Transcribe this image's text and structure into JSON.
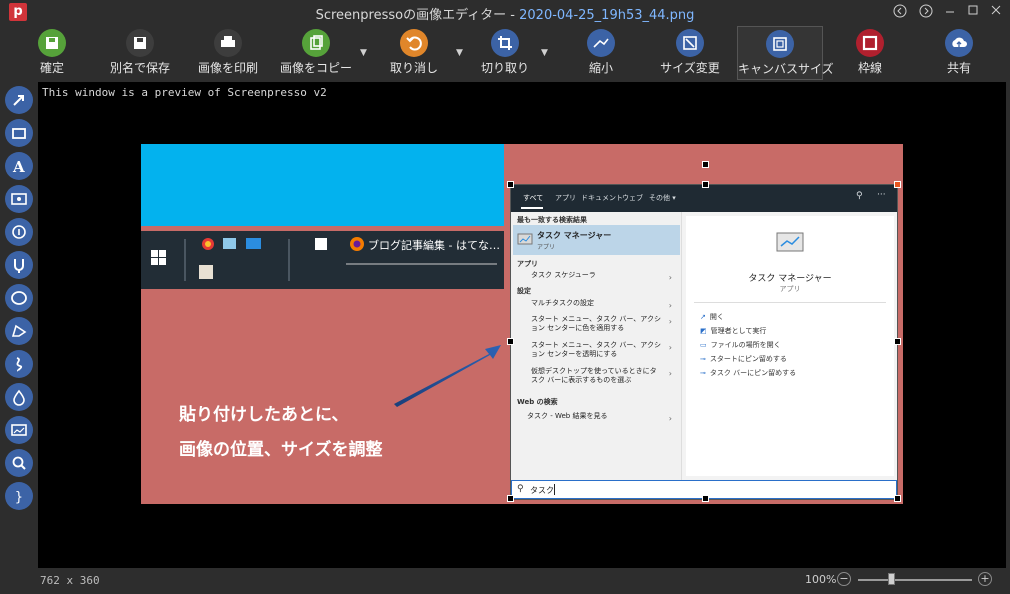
{
  "window": {
    "title_prefix": "Screenpressoの画像エディター -",
    "title_file": "2020-04-25_19h53_44.png",
    "logo_letter": "p"
  },
  "titlebar_controls": [
    "back-icon",
    "forward-icon",
    "minimize-icon",
    "maximize-icon",
    "close-icon"
  ],
  "toolbar": {
    "tools": [
      {
        "label": "確定",
        "icon": "save-icon",
        "color": "#56a23a"
      },
      {
        "label": "別名で保存",
        "icon": "save-as-icon",
        "color": "#3d3d3d"
      },
      {
        "label": "画像を印刷",
        "icon": "print-icon",
        "color": "#3d3d3d"
      },
      {
        "label": "画像をコピー",
        "icon": "copy-icon",
        "color": "#56a23a"
      },
      {
        "label": "取り消し",
        "icon": "undo-icon",
        "color": "#e0862a"
      },
      {
        "label": "切り取り",
        "icon": "crop-icon",
        "color": "#3c63a6"
      },
      {
        "label": "縮小",
        "icon": "resize-icon",
        "color": "#3c63a6"
      },
      {
        "label": "サイズ変更",
        "icon": "size-change-icon",
        "color": "#3c63a6"
      },
      {
        "label": "キャンバスサイズ",
        "icon": "canvas-size-icon",
        "color": "#3c63a6"
      },
      {
        "label": "枠線",
        "icon": "border-icon",
        "color": "#b0202e"
      },
      {
        "label": "共有",
        "icon": "share-icon",
        "color": "#3c63a6"
      }
    ]
  },
  "sidebar": {
    "tools": [
      "arrow-icon",
      "rectangle-icon",
      "text-icon",
      "callout-icon",
      "step-number-icon",
      "magnet-icon",
      "ellipse-icon",
      "polygon-icon",
      "freehand-icon",
      "blur-drop-icon",
      "image-icon",
      "magnifier-icon",
      "brace-icon"
    ]
  },
  "canvas": {
    "preview_note": "This window is a preview of Screenpresso v2"
  },
  "image": {
    "taskbar_tab": "ブログ記事編集 - はてな…",
    "win_tabs": [
      "すべて",
      "アプリ",
      "ドキュメント",
      "ウェブ",
      "その他 ▾"
    ],
    "best_match_header": "最も一致する検索結果",
    "best_match_title": "タスク マネージャー",
    "best_match_sub": "アプリ",
    "apps_header": "アプリ",
    "app_item": "タスク スケジューラ",
    "settings_header": "設定",
    "settings_items": [
      "マルチタスクの設定",
      "スタート メニュー、タスク バー、アクション センターに色を適用する",
      "スタート メニュー、タスク バー、アクション センターを透明にする",
      "仮想デスクトップを使っているときにタスク バーに表示するものを選ぶ"
    ],
    "web_header": "Web の検索",
    "web_item": "タスク - Web 結果を見る",
    "right_title": "タスク マネージャー",
    "right_sub": "アプリ",
    "right_actions": [
      "開く",
      "管理者として実行",
      "ファイルの場所を開く",
      "スタートにピン留めする",
      "タスク バーにピン留めする"
    ],
    "search_text": "タスク",
    "caption_line1": "貼り付けしたあとに、",
    "caption_line2": "画像の位置、サイズを調整"
  },
  "status": {
    "dimensions": "762 x 360",
    "zoom": "100%",
    "zoom_level_percent": 100
  }
}
